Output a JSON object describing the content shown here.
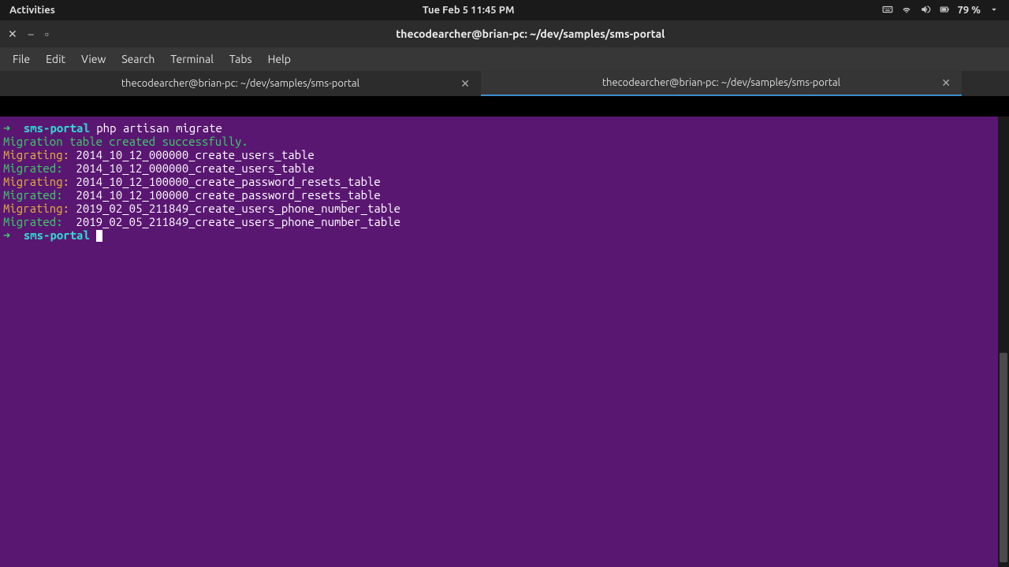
{
  "topbar": {
    "activities": "Activities",
    "datetime": "Tue Feb 5  11:45 PM",
    "battery_pct": "79 %"
  },
  "window": {
    "title": "thecodearcher@brian-pc: ~/dev/samples/sms-portal"
  },
  "menubar": {
    "items": [
      "File",
      "Edit",
      "View",
      "Search",
      "Terminal",
      "Tabs",
      "Help"
    ]
  },
  "tabs": [
    {
      "label": "thecodearcher@brian-pc: ~/dev/samples/sms-portal",
      "active": false
    },
    {
      "label": "thecodearcher@brian-pc: ~/dev/samples/sms-portal",
      "active": true
    }
  ],
  "terminal": {
    "prompt_arrow": "➜",
    "cwd": "sms-portal",
    "command": "php artisan migrate",
    "lines": [
      {
        "kind": "success",
        "text": "Migration table created successfully."
      },
      {
        "kind": "migrating",
        "label": "Migrating:",
        "name": "2014_10_12_000000_create_users_table"
      },
      {
        "kind": "migrated",
        "label": "Migrated:",
        "name": "2014_10_12_000000_create_users_table"
      },
      {
        "kind": "migrating",
        "label": "Migrating:",
        "name": "2014_10_12_100000_create_password_resets_table"
      },
      {
        "kind": "migrated",
        "label": "Migrated:",
        "name": "2014_10_12_100000_create_password_resets_table"
      },
      {
        "kind": "migrating",
        "label": "Migrating:",
        "name": "2019_02_05_211849_create_users_phone_number_table"
      },
      {
        "kind": "migrated",
        "label": "Migrated:",
        "name": "2019_02_05_211849_create_users_phone_number_table"
      }
    ]
  },
  "colors": {
    "term_bg": "#5a1772",
    "accent": "#3d8ec9",
    "green": "#3bd267",
    "yellow": "#e8b339",
    "cyan": "#33d7d0"
  }
}
